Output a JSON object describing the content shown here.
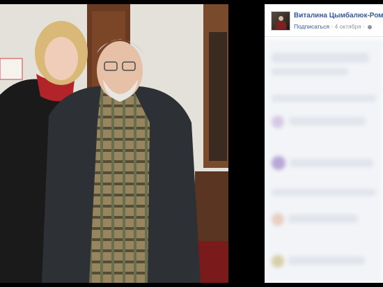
{
  "post": {
    "author_name": "Виталина Цымбалюк-Романовская",
    "follow_label": "Подписаться",
    "separator": "·",
    "date": "4 октября",
    "privacy_icon": "globe-icon"
  },
  "colors": {
    "link_blue": "#365899",
    "meta_gray": "#90949c",
    "viewer_bg": "#000000"
  }
}
